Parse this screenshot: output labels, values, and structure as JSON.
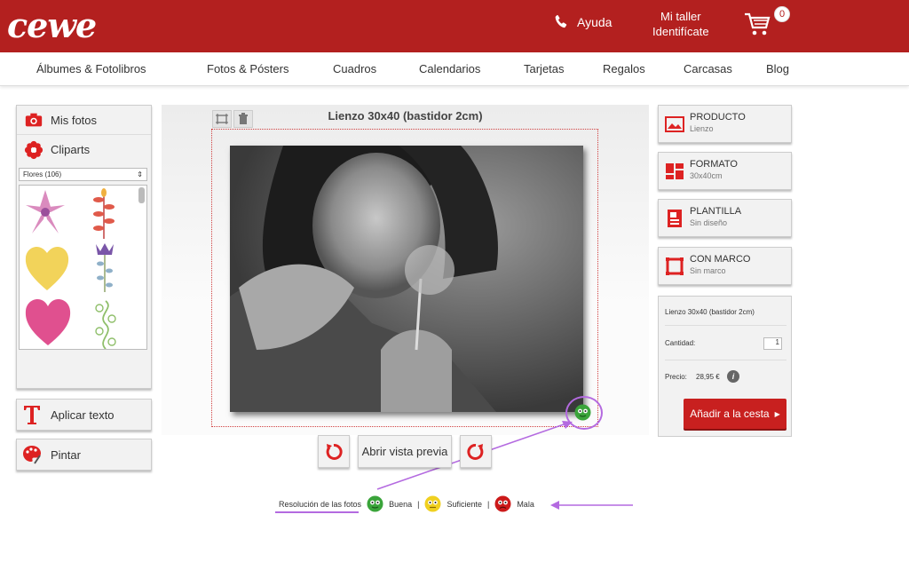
{
  "header": {
    "logo": "cewe",
    "help_label": "Ayuda",
    "account_line1": "Mi taller",
    "account_line2": "Identifícate",
    "cart_count": "0"
  },
  "nav": {
    "items": [
      "Álbumes & Fotolibros",
      "Fotos & Pósters",
      "Cuadros",
      "Calendarios",
      "Tarjetas",
      "Regalos",
      "Carcasas",
      "Blog"
    ]
  },
  "sidebar": {
    "my_photos": "Mis fotos",
    "cliparts": "Cliparts",
    "category_select": "Flores (106)",
    "add_text": "Aplicar texto",
    "paint": "Pintar"
  },
  "editor": {
    "title": "Lienzo 30x40 (bastidor 2cm)",
    "preview_button": "Abrir vista previa"
  },
  "legend": {
    "label": "Resolución de las fotos",
    "good": "Buena",
    "sufficient": "Suficiente",
    "bad": "Mala",
    "separator": "|"
  },
  "options": [
    {
      "title": "PRODUCTO",
      "value": "Lienzo"
    },
    {
      "title": "FORMATO",
      "value": "30x40cm"
    },
    {
      "title": "PLANTILLA",
      "value": "Sin diseño"
    },
    {
      "title": "CON MARCO",
      "value": "Sin marco"
    }
  ],
  "summary": {
    "product": "Lienzo 30x40 (bastidor 2cm)",
    "quantity_label": "Cantidad:",
    "quantity_value": "1",
    "price_label": "Precio:",
    "price_value": "28,95 €",
    "add_to_cart": "Añadir a la cesta"
  },
  "colors": {
    "brand_red": "#b3201f",
    "annotation_purple": "#b46ae0",
    "good_green": "#3aa43a",
    "sufficient_yellow": "#f0d020",
    "bad_red": "#cc1a1a"
  }
}
